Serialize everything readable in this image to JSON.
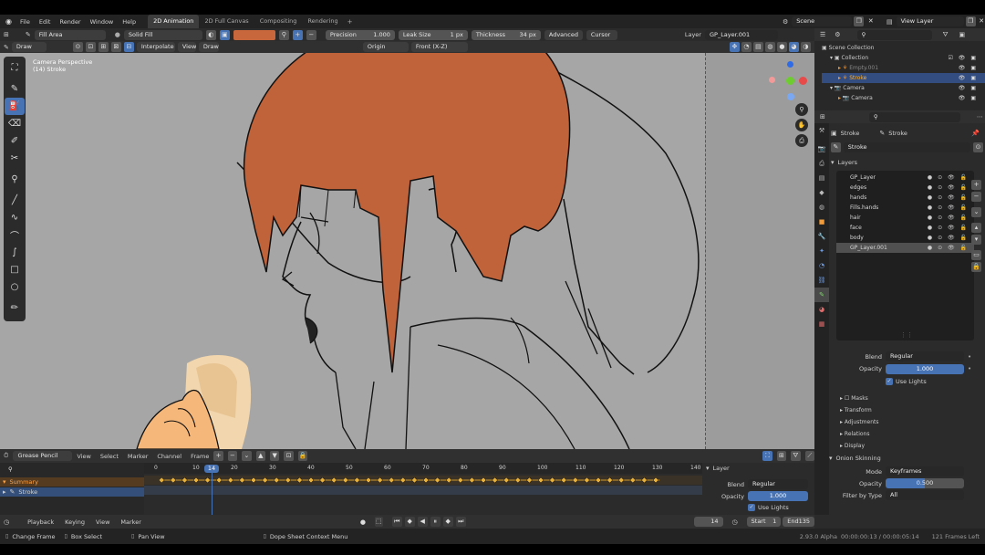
{
  "topbar": {
    "menus": [
      "File",
      "Edit",
      "Render",
      "Window",
      "Help"
    ],
    "workspaces": [
      "2D Animation",
      "2D Full Canvas",
      "Compositing",
      "Rendering"
    ],
    "active_workspace": "2D Animation",
    "scene": "Scene",
    "view_layer": "View Layer"
  },
  "toolheader": {
    "mode": "Draw",
    "fill_mode": "Fill Area",
    "fill_type": "Solid Fill",
    "precision_label": "Precision",
    "precision": "1.000",
    "leak_label": "Leak Size",
    "leak": "1 px",
    "thickness_label": "Thickness",
    "thickness": "34 px",
    "advanced": "Advanced",
    "cursor": "Cursor",
    "layer_label": "Layer",
    "layer": "GP_Layer.001",
    "fill_color": "#c8673b"
  },
  "viewport_header": {
    "items": [
      "Draw",
      "Interpolate",
      "View",
      "Draw"
    ],
    "origin": "Origin",
    "view": "Front (X-Z)"
  },
  "viewport": {
    "title": "Camera Perspective",
    "subtitle": "(14) Stroke",
    "bg": "#a6a6a6",
    "hair_color": "#c0623a"
  },
  "outliner": {
    "scene_collection": "Scene Collection",
    "items": [
      {
        "name": "Collection",
        "depth": 1
      },
      {
        "name": "Empty.001",
        "depth": 2
      },
      {
        "name": "Stroke",
        "depth": 2,
        "selected": true
      },
      {
        "name": "Camera",
        "depth": 1
      },
      {
        "name": "Camera",
        "depth": 2
      }
    ]
  },
  "properties": {
    "obj1": "Stroke",
    "obj2": "Stroke",
    "data_name": "Stroke",
    "layers_title": "Layers",
    "layers": [
      "GP_Layer",
      "edges",
      "hands",
      "Fills.hands",
      "hair",
      "face",
      "body",
      "GP_Layer.001"
    ],
    "selected_layer": "GP_Layer.001",
    "blend_label": "Blend",
    "blend": "Regular",
    "opacity_label": "Opacity",
    "opacity": "1.000",
    "use_lights": "Use Lights",
    "sections": [
      "Masks",
      "Transform",
      "Adjustments",
      "Relations",
      "Display"
    ],
    "onion": "Onion Skinning",
    "mode_label": "Mode",
    "mode": "Keyframes",
    "onion_opacity_label": "Opacity",
    "onion_opacity": "0.500",
    "filter_label": "Filter by Type",
    "filter": "All"
  },
  "dopesheet": {
    "editor": "Grease Pencil",
    "menus": [
      "View",
      "Select",
      "Marker",
      "Channel",
      "Frame"
    ],
    "summary": "Summary",
    "channel": "Stroke",
    "ticks": [
      "0",
      "10",
      "20",
      "30",
      "40",
      "50",
      "60",
      "70",
      "80",
      "90",
      "100",
      "110",
      "120",
      "130",
      "140"
    ],
    "current": "14",
    "layer_title": "Layer",
    "blend_label": "Blend",
    "blend": "Regular",
    "opacity_label": "Opacity",
    "opacity": "1.000",
    "use_lights": "Use Lights"
  },
  "timeline": {
    "menus": [
      "Playback",
      "Keying",
      "View",
      "Marker"
    ],
    "frame": "14",
    "start_label": "Start",
    "start": "1",
    "end_label": "End",
    "end": "135"
  },
  "status": {
    "left": [
      "Change Frame",
      "Box Select",
      "Pan View"
    ],
    "context": "Dope Sheet Context Menu",
    "version": "2.93.0 Alpha",
    "time": "00:00:00:13 / 00:00:05:14",
    "frames_left": "121 Frames Left"
  }
}
